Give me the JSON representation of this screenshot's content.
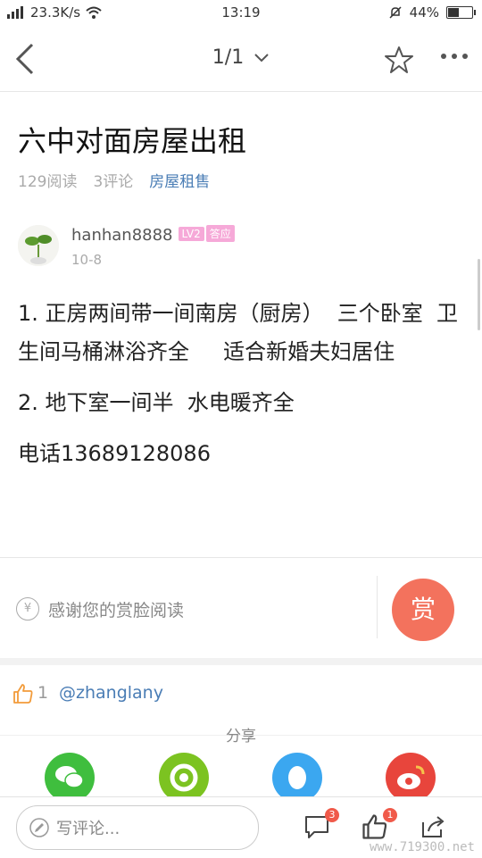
{
  "status_bar": {
    "network_speed": "23.3K/s",
    "time": "13:19",
    "battery": "44%"
  },
  "nav": {
    "page_indicator": "1/1"
  },
  "post": {
    "title": "六中对面房屋出租",
    "reads": "129阅读",
    "comments": "3评论",
    "category": "房屋租售",
    "author": {
      "name": "hanhan8888",
      "level_badge": "LV2",
      "answer_badge": "答应",
      "date": "10-8"
    },
    "paragraphs": [
      "1. 正房两间带一间南房（厨房）  三个卧室  卫生间马桶淋浴齐全     适合新婚夫妇居住",
      "2. 地下室一间半  水电暖齐全",
      "电话13689128086"
    ]
  },
  "reward": {
    "icon_symbol": "¥",
    "prompt": "感谢您的赏脸阅读",
    "button_label": "赏"
  },
  "likes": {
    "count": "1",
    "user": "@zhanglany"
  },
  "share": {
    "label": "分享",
    "targets": [
      {
        "icon": "wechat-icon",
        "color": "#3fbe3e"
      },
      {
        "icon": "moments-icon",
        "color": "#7cc321"
      },
      {
        "icon": "qq-icon",
        "color": "#3ba7f0"
      },
      {
        "icon": "weibo-icon",
        "color": "#e8453c"
      }
    ]
  },
  "bottom_bar": {
    "comment_placeholder": "写评论...",
    "comment_badge": "3",
    "like_badge": "1"
  },
  "watermark": "www.719300.net"
}
